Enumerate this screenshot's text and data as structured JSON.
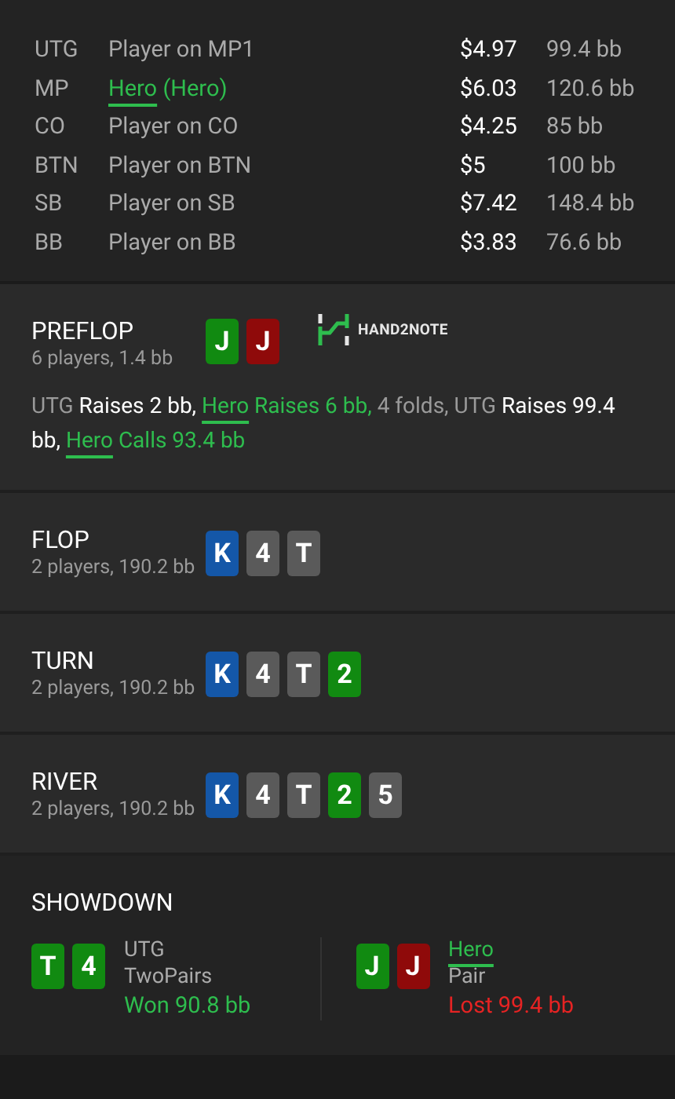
{
  "players": [
    {
      "position": "UTG",
      "name": "Player on MP1",
      "hero": false,
      "stack": "$4.97",
      "bb": "99.4 bb"
    },
    {
      "position": "MP",
      "name": "Hero",
      "note": "(Hero)",
      "hero": true,
      "stack": "$6.03",
      "bb": "120.6 bb"
    },
    {
      "position": "CO",
      "name": "Player on CO",
      "hero": false,
      "stack": "$4.25",
      "bb": "85 bb"
    },
    {
      "position": "BTN",
      "name": "Player on BTN",
      "hero": false,
      "stack": "$5",
      "bb": "100 bb"
    },
    {
      "position": "SB",
      "name": "Player on SB",
      "hero": false,
      "stack": "$7.42",
      "bb": "148.4 bb"
    },
    {
      "position": "BB",
      "name": "Player on BB",
      "hero": false,
      "stack": "$3.83",
      "bb": "76.6 bb"
    }
  ],
  "streets": [
    {
      "name": "PREFLOP",
      "info": "6 players, 1.4 bb",
      "cards": [
        {
          "rank": "J",
          "color": "#118a11"
        },
        {
          "rank": "J",
          "color": "#8f0a0a"
        }
      ],
      "logo": {
        "text": "HAND2NOTE"
      },
      "actions": [
        {
          "text": "UTG",
          "kind": "position"
        },
        {
          "text": " Raises 2 bb, ",
          "kind": "action"
        },
        {
          "text": "Hero",
          "kind": "hero"
        },
        {
          "text": " Raises 6 bb,",
          "kind": "hero-action"
        },
        {
          "text": " 4 folds, UTG",
          "kind": "plain"
        },
        {
          "text": " Raises 99.4 bb, ",
          "kind": "action"
        },
        {
          "text": "Hero",
          "kind": "hero"
        },
        {
          "text": " Calls 93.4 bb",
          "kind": "hero-action"
        }
      ]
    },
    {
      "name": "FLOP",
      "info": "2 players, 190.2 bb",
      "cards": [
        {
          "rank": "K",
          "color": "#1457a8"
        },
        {
          "rank": "4",
          "color": "#5a5a5a"
        },
        {
          "rank": "T",
          "color": "#5a5a5a"
        }
      ]
    },
    {
      "name": "TURN",
      "info": "2 players, 190.2 bb",
      "cards": [
        {
          "rank": "K",
          "color": "#1457a8"
        },
        {
          "rank": "4",
          "color": "#5a5a5a"
        },
        {
          "rank": "T",
          "color": "#5a5a5a"
        },
        {
          "rank": "2",
          "color": "#118a11"
        }
      ]
    },
    {
      "name": "RIVER",
      "info": "2 players, 190.2 bb",
      "cards": [
        {
          "rank": "K",
          "color": "#1457a8"
        },
        {
          "rank": "4",
          "color": "#5a5a5a"
        },
        {
          "rank": "T",
          "color": "#5a5a5a"
        },
        {
          "rank": "2",
          "color": "#118a11"
        },
        {
          "rank": "5",
          "color": "#5a5a5a"
        }
      ]
    }
  ],
  "showdown": {
    "title": "SHOWDOWN",
    "hands": [
      {
        "player": "UTG",
        "hero": false,
        "hand": "TwoPairs",
        "result": "Won 90.8 bb",
        "won": true,
        "cards": [
          {
            "rank": "T",
            "color": "#118a11"
          },
          {
            "rank": "4",
            "color": "#118a11"
          }
        ]
      },
      {
        "player": "Hero",
        "hero": true,
        "hand": "Pair",
        "result": "Lost 99.4 bb",
        "won": false,
        "cards": [
          {
            "rank": "J",
            "color": "#118a11"
          },
          {
            "rank": "J",
            "color": "#8f0a0a"
          }
        ]
      }
    ]
  }
}
